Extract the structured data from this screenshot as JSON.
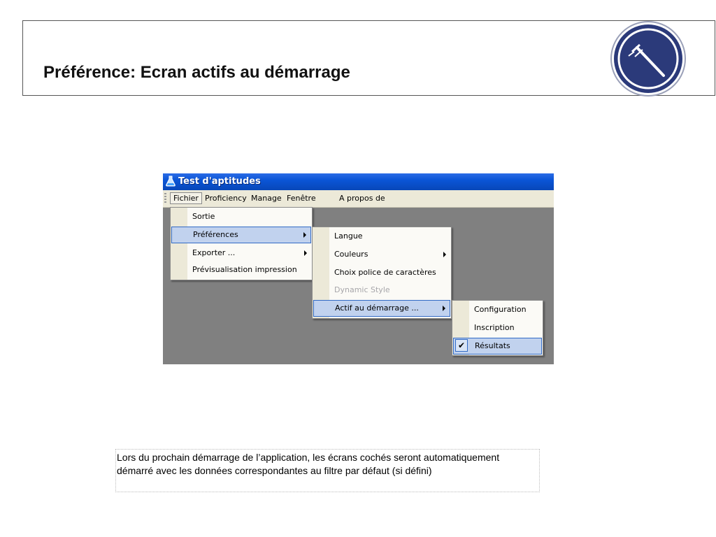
{
  "slide": {
    "title": "Préférence: Ecran actifs au démarrage",
    "logo_icon": "gavel-icon",
    "logo_color": "#2b3a7a"
  },
  "app": {
    "title": "Test d'aptitudes",
    "app_icon": "flask-icon",
    "titlebar_color": "#0a55d6",
    "workspace_color": "#808080",
    "menubar": {
      "items": [
        "Fichier",
        "Proficiency",
        "Manage",
        "Fenêtre",
        "A propos de"
      ],
      "open_item": "Fichier"
    },
    "fichier_menu": {
      "items": [
        {
          "label": "Sortie"
        },
        {
          "label": "Préférences",
          "submenu": true,
          "selected": true
        },
        {
          "label": "Exporter ...",
          "submenu": true
        },
        {
          "label": "Prévisualisation impression"
        }
      ]
    },
    "preferences_menu": {
      "items": [
        {
          "label": "Langue"
        },
        {
          "label": "Couleurs",
          "submenu": true
        },
        {
          "label": "Choix police de caractères"
        },
        {
          "label": "Dynamic Style",
          "disabled": true
        },
        {
          "label": "Actif au démarrage ...",
          "submenu": true,
          "selected": true
        }
      ]
    },
    "actif_menu": {
      "items": [
        {
          "label": "Configuration"
        },
        {
          "label": "Inscription"
        },
        {
          "label": "Résultats",
          "checked": true,
          "selected": true
        }
      ],
      "check_icon": "checkmark-icon"
    },
    "selection_color": "#c1d2ee"
  },
  "caption": {
    "text": "Lors du prochain démarrage de l’application, les écrans cochés seront automatiquement démarré avec les données correspondantes au filtre par défaut (si défini)"
  }
}
